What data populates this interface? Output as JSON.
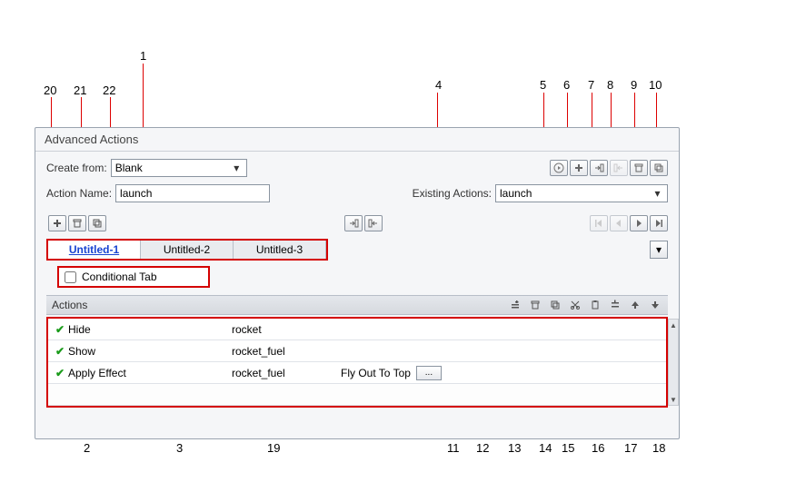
{
  "dialog_title": "Advanced Actions",
  "create_from": {
    "label": "Create from:",
    "value": "Blank"
  },
  "action_name": {
    "label": "Action Name:",
    "value": "launch"
  },
  "existing_actions": {
    "label": "Existing Actions:",
    "value": "launch"
  },
  "tabs": [
    {
      "label": "Untitled-1",
      "active": true
    },
    {
      "label": "Untitled-2",
      "active": false
    },
    {
      "label": "Untitled-3",
      "active": false
    }
  ],
  "conditional": {
    "label": "Conditional Tab",
    "checked": false
  },
  "actions_header": "Actions",
  "actions_rows": [
    {
      "cmd": "Hide",
      "target": "rocket",
      "extra": ""
    },
    {
      "cmd": "Show",
      "target": "rocket_fuel",
      "extra": ""
    },
    {
      "cmd": "Apply Effect",
      "target": "rocket_fuel",
      "extra": "Fly Out To Top"
    }
  ],
  "ellipsis": "...",
  "callouts": {
    "1": "1",
    "2": "2",
    "3": "3",
    "4": "4",
    "5": "5",
    "6": "6",
    "7": "7",
    "8": "8",
    "9": "9",
    "10": "10",
    "11": "11",
    "12": "12",
    "13": "13",
    "14": "14",
    "15": "15",
    "16": "16",
    "17": "17",
    "18": "18",
    "19": "19",
    "20": "20",
    "21": "21",
    "22": "22"
  }
}
